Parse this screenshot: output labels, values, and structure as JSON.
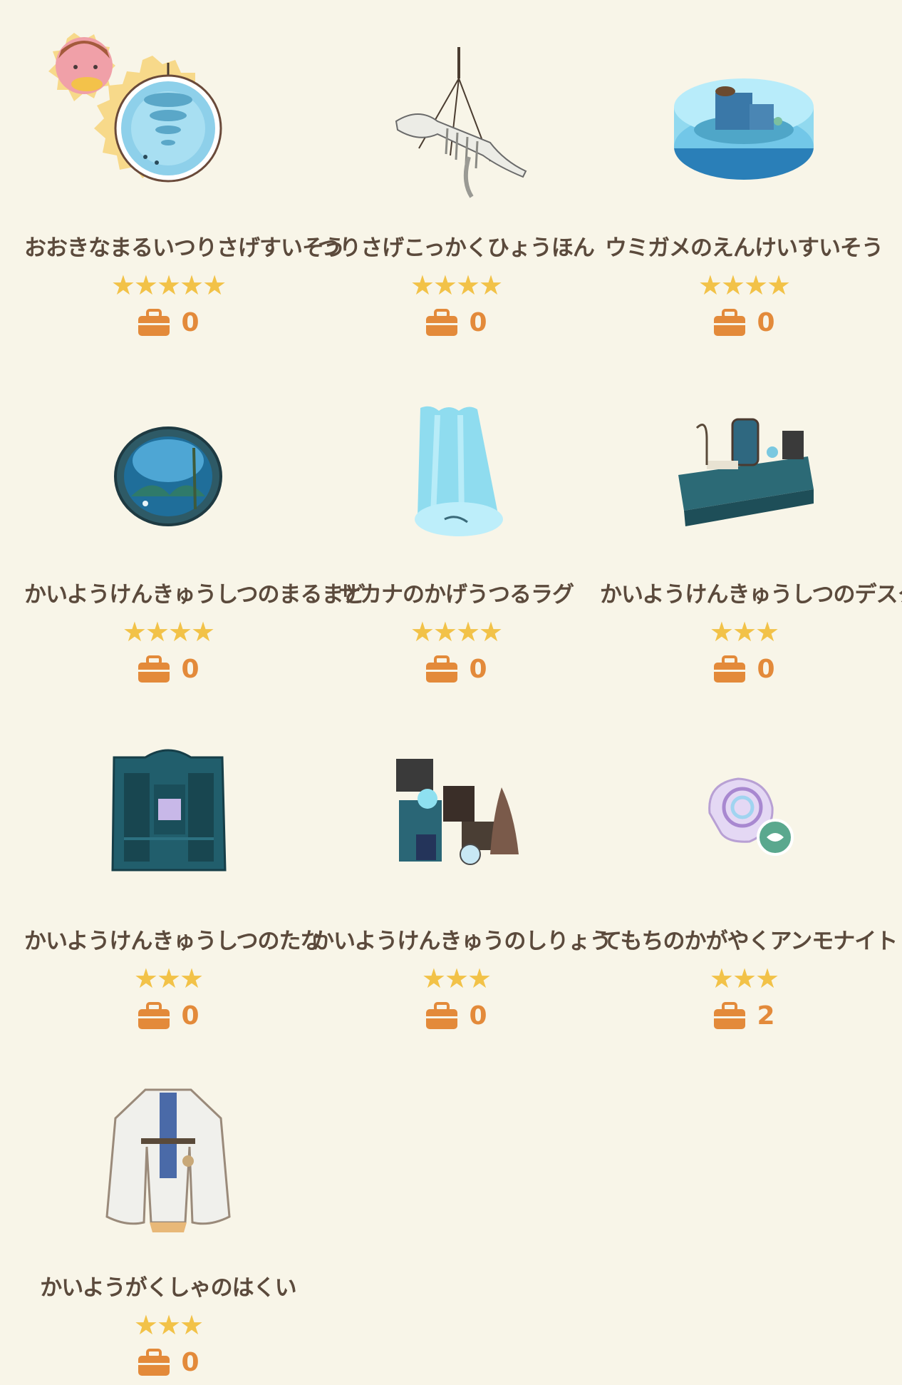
{
  "items": [
    {
      "name": "おおきなまるいつりさげすいそう",
      "stars": "★★★★★",
      "count": "0",
      "icon": "hanging-round-aquarium-icon"
    },
    {
      "name": "つりさげこっかくひょうほん",
      "stars": "★★★★",
      "count": "0",
      "icon": "hanging-skeleton-specimen-icon"
    },
    {
      "name": "ウミガメのえんけいすいそう",
      "stars": "★★★★",
      "count": "0",
      "icon": "sea-turtle-round-tank-icon"
    },
    {
      "name": "かいようけんきゅうしつのまるまど",
      "stars": "★★★★",
      "count": "0",
      "icon": "round-window-icon"
    },
    {
      "name": "サカナのかげうつるラグ",
      "stars": "★★★★",
      "count": "0",
      "icon": "fish-shadow-rug-icon"
    },
    {
      "name": "かいようけんきゅうしつのデスク",
      "stars": "★★★",
      "count": "0",
      "icon": "lab-desk-icon"
    },
    {
      "name": "かいようけんきゅうしつのたな",
      "stars": "★★★",
      "count": "0",
      "icon": "lab-shelf-icon"
    },
    {
      "name": "かいようけんきゅうのしりょう",
      "stars": "★★★",
      "count": "0",
      "icon": "research-materials-icon"
    },
    {
      "name": "てもちのかがやくアンモナイト",
      "stars": "★★★",
      "count": "2",
      "icon": "shining-ammonite-icon"
    },
    {
      "name": "かいようがくしゃのはくい",
      "stars": "★★★",
      "count": "0",
      "icon": "lab-coat-icon"
    }
  ],
  "bag_icon": "bag-icon",
  "colors": {
    "background": "#f8f5e8",
    "star": "#f2c248",
    "count": "#e38a3a",
    "name": "#5b4a3c"
  }
}
